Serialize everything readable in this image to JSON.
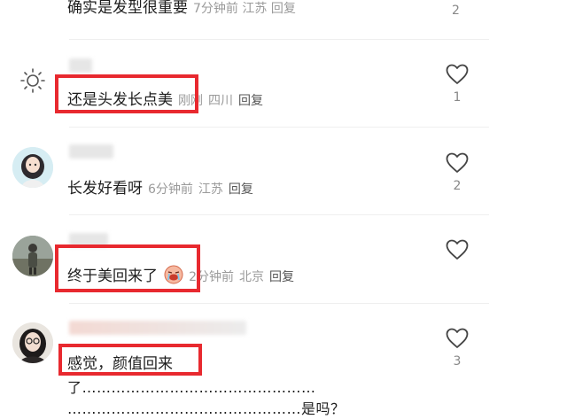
{
  "comments": [
    {
      "text": "确实是发型很重要",
      "time": "7分钟前",
      "location": "江苏",
      "reply": "回复",
      "likes": "2"
    },
    {
      "text": "还是头发长点美",
      "time": "刚刚",
      "location": "四川",
      "reply": "回复",
      "likes": "1"
    },
    {
      "text": "长发好看呀",
      "time": "6分钟前",
      "location": "江苏",
      "reply": "回复",
      "likes": "2"
    },
    {
      "text": "终于美回来了",
      "time": "2分钟前",
      "location": "北京",
      "reply": "回复",
      "likes": ""
    },
    {
      "text": "感觉，颜值回来",
      "continuation_1": "了…………………………………………",
      "continuation_2": "…………………………………………是吗？",
      "likes": "3"
    }
  ],
  "colors": {
    "highlight": "#e8292f",
    "meta": "#9a9a9a",
    "text": "#1e1e1e"
  },
  "icons": {
    "like": "heart-outline-icon",
    "emoji": "crying-face-emoji"
  }
}
